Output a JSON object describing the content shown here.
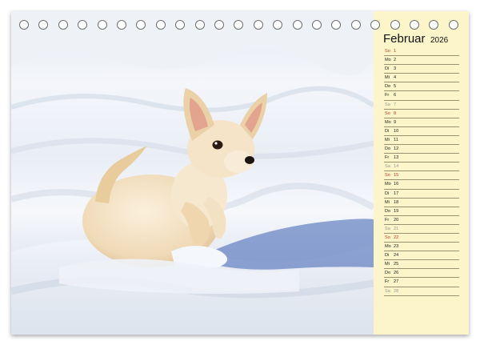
{
  "calendar": {
    "month": "Februar",
    "year": "2026",
    "days": [
      {
        "name": "So",
        "num": "1",
        "type": "sun"
      },
      {
        "name": "Mo",
        "num": "2",
        "type": "week"
      },
      {
        "name": "Di",
        "num": "3",
        "type": "week"
      },
      {
        "name": "Mi",
        "num": "4",
        "type": "week"
      },
      {
        "name": "Do",
        "num": "5",
        "type": "week"
      },
      {
        "name": "Fr",
        "num": "6",
        "type": "week"
      },
      {
        "name": "Sa",
        "num": "7",
        "type": "sat"
      },
      {
        "name": "So",
        "num": "8",
        "type": "sun"
      },
      {
        "name": "Mo",
        "num": "9",
        "type": "week"
      },
      {
        "name": "Di",
        "num": "10",
        "type": "week"
      },
      {
        "name": "Mi",
        "num": "11",
        "type": "week"
      },
      {
        "name": "Do",
        "num": "12",
        "type": "week"
      },
      {
        "name": "Fr",
        "num": "13",
        "type": "week"
      },
      {
        "name": "Sa",
        "num": "14",
        "type": "sat"
      },
      {
        "name": "So",
        "num": "15",
        "type": "sun"
      },
      {
        "name": "Mo",
        "num": "16",
        "type": "week"
      },
      {
        "name": "Di",
        "num": "17",
        "type": "week"
      },
      {
        "name": "Mi",
        "num": "18",
        "type": "week"
      },
      {
        "name": "Do",
        "num": "19",
        "type": "week"
      },
      {
        "name": "Fr",
        "num": "20",
        "type": "week"
      },
      {
        "name": "Sa",
        "num": "21",
        "type": "sat"
      },
      {
        "name": "So",
        "num": "22",
        "type": "sun"
      },
      {
        "name": "Mo",
        "num": "23",
        "type": "week"
      },
      {
        "name": "Di",
        "num": "24",
        "type": "week"
      },
      {
        "name": "Mi",
        "num": "25",
        "type": "week"
      },
      {
        "name": "Do",
        "num": "26",
        "type": "week"
      },
      {
        "name": "Fr",
        "num": "27",
        "type": "week"
      },
      {
        "name": "Sa",
        "num": "28",
        "type": "sat"
      }
    ]
  },
  "colors": {
    "panel_background": "#fbf5c9",
    "sunday_text": "#c0392b",
    "saturday_text": "#999999",
    "ring_border": "#6f6f6f"
  },
  "photo_subject": "chihuahua puppy in snow"
}
